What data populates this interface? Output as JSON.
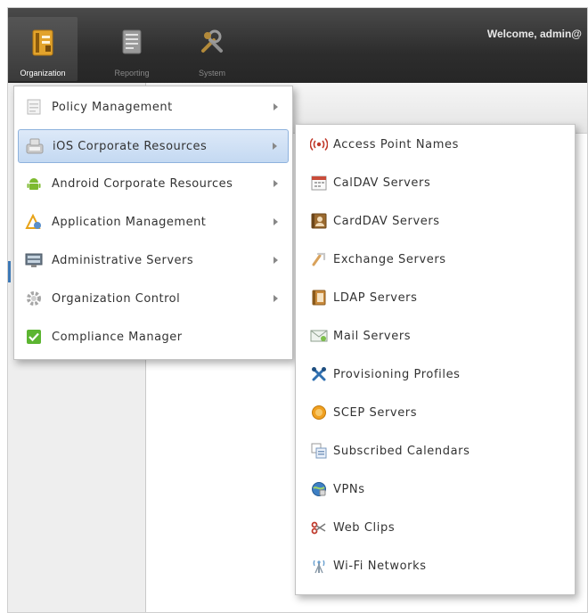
{
  "toolbar": {
    "items": [
      {
        "label": "Organization",
        "icon": "binder-icon",
        "active": true
      },
      {
        "label": "Reporting",
        "icon": "report-icon",
        "active": false
      },
      {
        "label": "System",
        "icon": "tools-icon",
        "active": false
      }
    ],
    "welcome": "Welcome, admin@"
  },
  "main_menu": {
    "items": [
      {
        "label": "Policy Management",
        "icon": "policy-doc-icon",
        "submenu": true
      },
      {
        "label": "iOS Corporate Resources",
        "icon": "ios-device-icon",
        "submenu": true,
        "selected": true
      },
      {
        "label": "Android Corporate Resources",
        "icon": "android-icon",
        "submenu": true
      },
      {
        "label": "Application Management",
        "icon": "app-management-icon",
        "submenu": true
      },
      {
        "label": "Administrative Servers",
        "icon": "servers-icon",
        "submenu": true
      },
      {
        "label": "Organization Control",
        "icon": "gear-icon",
        "submenu": true
      },
      {
        "label": "Compliance Manager",
        "icon": "check-icon",
        "submenu": false
      }
    ]
  },
  "submenu": {
    "items": [
      {
        "label": "Access Point Names",
        "icon": "broadcast-icon"
      },
      {
        "label": "CalDAV Servers",
        "icon": "calendar-icon"
      },
      {
        "label": "CardDAV Servers",
        "icon": "contact-card-icon"
      },
      {
        "label": "Exchange Servers",
        "icon": "exchange-icon"
      },
      {
        "label": "LDAP Servers",
        "icon": "address-book-icon"
      },
      {
        "label": "Mail Servers",
        "icon": "mail-icon"
      },
      {
        "label": "Provisioning Profiles",
        "icon": "wrench-icon"
      },
      {
        "label": "SCEP Servers",
        "icon": "certificate-icon"
      },
      {
        "label": "Subscribed Calendars",
        "icon": "subscribed-calendar-icon"
      },
      {
        "label": "VPNs",
        "icon": "vpn-icon"
      },
      {
        "label": "Web Clips",
        "icon": "scissors-icon"
      },
      {
        "label": "Wi-Fi Networks",
        "icon": "wifi-antenna-icon"
      }
    ]
  },
  "colors": {
    "toolbar_bg": "#2d2d2d",
    "selected_bg": "#c4d9f2",
    "selected_border": "#8eb2dd",
    "accent_orange": "#e8a317"
  }
}
